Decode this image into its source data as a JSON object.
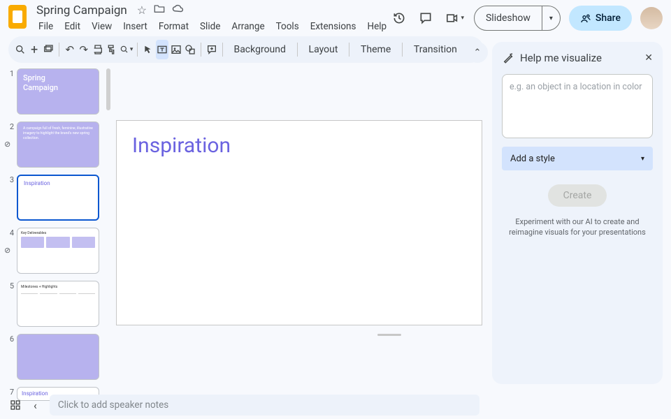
{
  "header": {
    "doc_title": "Spring Campaign",
    "menus": [
      "File",
      "Edit",
      "View",
      "Insert",
      "Format",
      "Slide",
      "Arrange",
      "Tools",
      "Extensions",
      "Help"
    ],
    "slideshow_label": "Slideshow",
    "share_label": "Share"
  },
  "toolbar": {
    "background": "Background",
    "layout": "Layout",
    "theme": "Theme",
    "transition": "Transition"
  },
  "slides": {
    "s1_line1": "Spring",
    "s1_line2": "Campaign",
    "s2_text": "A campaign full of fresh, feminine, illustrative imagery to highlight the brand's new spring collection.",
    "s3_title": "Inspiration",
    "s4_title": "Key Deliverables",
    "s5_title": "Milestones + Highlights",
    "s7_title": "Inspiration"
  },
  "canvas": {
    "title": "Inspiration"
  },
  "notes": {
    "placeholder": "Click to add speaker notes"
  },
  "sidepanel": {
    "title": "Help me visualize",
    "input_placeholder": "e.g. an object in a location in color",
    "style_label": "Add a style",
    "create_label": "Create",
    "footer": "Experiment with our AI to create and reimagine visuals for your presentations"
  }
}
